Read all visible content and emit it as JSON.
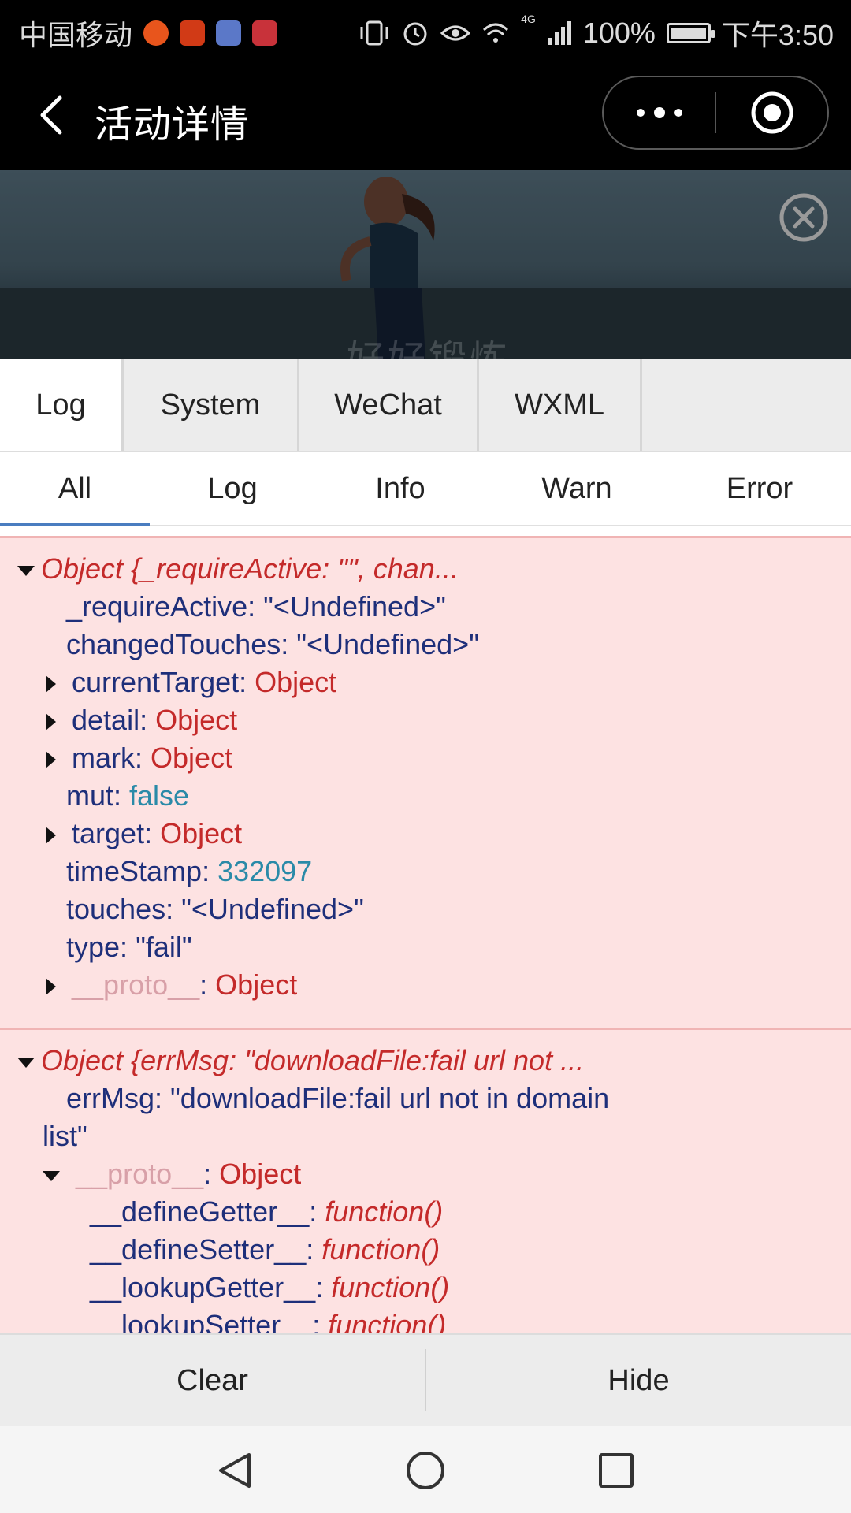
{
  "status_bar": {
    "carrier": "中国移动",
    "network": "4G",
    "battery": "100%",
    "battery_level": 1.0,
    "time": "下午3:50",
    "app_icons": [
      "listen-app-icon",
      "music-app-icon",
      "mall-app-icon"
    ]
  },
  "nav": {
    "title": "活动详情"
  },
  "banner": {
    "text": "好好锻炼"
  },
  "console": {
    "main_tabs": [
      {
        "label": "Log"
      },
      {
        "label": "System"
      },
      {
        "label": "WeChat"
      },
      {
        "label": "WXML"
      }
    ],
    "filter_tabs": [
      {
        "label": "All"
      },
      {
        "label": "Log"
      },
      {
        "label": "Info"
      },
      {
        "label": "Warn"
      },
      {
        "label": "Error"
      }
    ],
    "entry1": {
      "header": "Object {_requireActive: \"\", chan...",
      "rows": [
        {
          "key": "_requireActive",
          "sep": ": ",
          "value": "\"<Undefined>\""
        },
        {
          "key": "changedTouches",
          "sep": ": ",
          "value": "\"<Undefined>\""
        },
        {
          "key": "currentTarget",
          "sep": ": ",
          "value": "Object"
        },
        {
          "key": "detail",
          "sep": ": ",
          "value": "Object"
        },
        {
          "key": "mark",
          "sep": ": ",
          "value": "Object"
        },
        {
          "key": "mut",
          "sep": ": ",
          "value": "false"
        },
        {
          "key": "target",
          "sep": ": ",
          "value": "Object"
        },
        {
          "key": "timeStamp",
          "sep": ": ",
          "value": "332097"
        },
        {
          "key": "touches",
          "sep": ": ",
          "value": "\"<Undefined>\""
        },
        {
          "key": "type",
          "sep": ": ",
          "value": "\"fail\""
        },
        {
          "key": "__proto__",
          "sep": ": ",
          "value": "Object"
        }
      ]
    },
    "entry2": {
      "header": "Object {errMsg: \"downloadFile:fail url not ...",
      "errmsg_key": "errMsg",
      "errmsg_sep": ": ",
      "errmsg_value_line1": "\"downloadFile:fail url not in domain",
      "errmsg_value_line2": "list\"",
      "proto_key": "__proto__",
      "proto_sep": ": ",
      "proto_value": "Object",
      "proto_rows": [
        {
          "key": "__defineGetter__",
          "sep": ": ",
          "value": "function()"
        },
        {
          "key": "__defineSetter__",
          "sep": ": ",
          "value": "function()"
        },
        {
          "key": "__lookupGetter__",
          "sep": ": ",
          "value": "function()"
        },
        {
          "key": "__lookupSetter__",
          "sep": ": ",
          "value": "function()"
        }
      ]
    },
    "footer": {
      "clear": "Clear",
      "hide": "Hide"
    }
  }
}
